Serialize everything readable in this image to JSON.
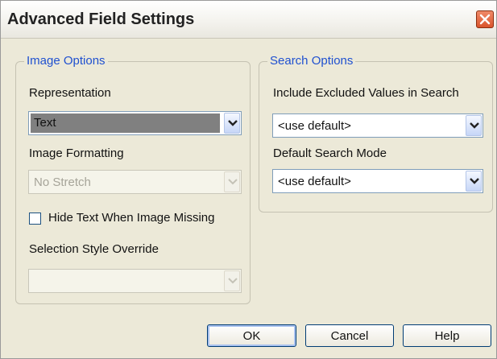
{
  "dialog": {
    "title": "Advanced Field Settings"
  },
  "image_options": {
    "legend": "Image Options",
    "representation_label": "Representation",
    "representation_value": "Text",
    "formatting_label": "Image Formatting",
    "formatting_value": "No Stretch",
    "hide_text_label": "Hide Text When Image Missing",
    "hide_text_checked": false,
    "selection_style_label": "Selection Style Override",
    "selection_style_value": ""
  },
  "search_options": {
    "legend": "Search Options",
    "include_excluded_label": "Include Excluded Values in Search",
    "include_excluded_value": "<use default>",
    "default_mode_label": "Default Search Mode",
    "default_mode_value": "<use default>"
  },
  "buttons": {
    "ok": "OK",
    "cancel": "Cancel",
    "help": "Help"
  },
  "colors": {
    "group_legend": "#1f50d0",
    "close_button": "#d9542c",
    "selected_item": "#808080"
  },
  "icons": {
    "close": "close-icon",
    "dropdown": "chevron-down-icon"
  }
}
